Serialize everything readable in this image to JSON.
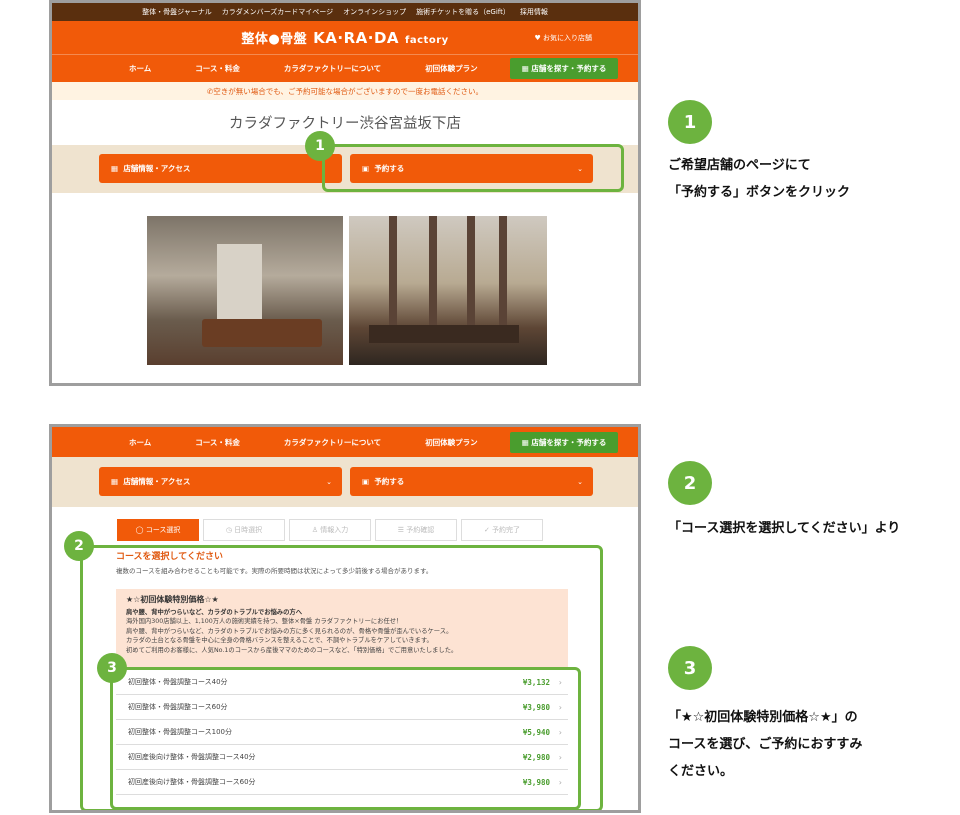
{
  "topbar": {
    "items": [
      "整体・骨盤ジャーナル",
      "カラダメンバーズカードマイページ",
      "オンラインショップ",
      "施術チケットを贈る（eGift）",
      "採用情報"
    ]
  },
  "header": {
    "logo_left": "整体●骨盤",
    "logo_main": "KA·RA·DA",
    "logo_sub": "factory",
    "favorite": "お気に入り店舗"
  },
  "nav": {
    "items": [
      "ホーム",
      "コース・料金",
      "カラダファクトリーについて",
      "初回体験プラン"
    ],
    "cta": "店舗を探す・予約する"
  },
  "notice": "空きが無い場合でも、ご予約可能な場合がございますので一度お電話ください。",
  "store_title": "カラダファクトリー渋谷宮益坂下店",
  "buttons": {
    "info": "店舗情報・アクセス",
    "reserve": "予約する"
  },
  "steps": [
    "コース選択",
    "日時選択",
    "情報入力",
    "予約確認",
    "予約完了"
  ],
  "course": {
    "heading": "コースを選択してください",
    "sub": "複数のコースを組み合わせることも可能です。実際の所要時間は状況によって多少前後する場合があります。",
    "promo_title": "★☆初回体験特別価格☆★",
    "promo_sub": "肩や腰、背中がつらいなど、カラダのトラブルでお悩みの方へ",
    "promo_lines": [
      "海外国内300店舗以上、1,100万人の施術実績を持つ、整体×骨盤 カラダファクトリーにお任せ！",
      "肩や腰、背中がつらいなど、カラダのトラブルでお悩みの方に多く見られるのが、骨格や骨盤が歪んでいるケース。",
      "カラダの土台となる骨盤を中心に全身の骨格バランスを整えることで、不調やトラブルをケアしていきます。",
      "初めてご利用のお客様に、人気No.1のコースから産後ママのためのコースなど、「特別価格」でご用意いたしました。"
    ],
    "items": [
      {
        "name": "初回整体・骨盤調整コース40分",
        "price": "¥3,132"
      },
      {
        "name": "初回整体・骨盤調整コース60分",
        "price": "¥3,980"
      },
      {
        "name": "初回整体・骨盤調整コース100分",
        "price": "¥5,940"
      },
      {
        "name": "初回産後向け整体・骨盤調整コース40分",
        "price": "¥2,980"
      },
      {
        "name": "初回産後向け整体・骨盤調整コース60分",
        "price": "¥3,980"
      }
    ]
  },
  "callouts": {
    "n1": "1",
    "n2": "2",
    "n3": "3",
    "step1_line1": "ご希望店舗のページにて",
    "step1_line2": "「予約する」ボタンをクリック",
    "step2_line1": "「コース選択を選択してください」より",
    "step3_line1": "「★☆初回体験特別価格☆★」の",
    "step3_line2": "コースを選び、ご予約におすすみ",
    "step3_line3": "ください。"
  }
}
